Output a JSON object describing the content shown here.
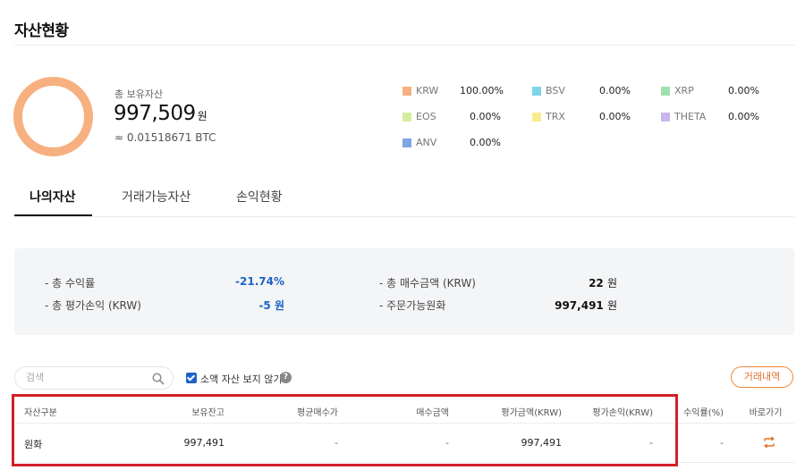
{
  "page": {
    "title": "자산현황"
  },
  "holdings": {
    "total_label": "총 보유자산",
    "total_value": "997,509",
    "total_unit": "원",
    "btc_equivalent": "≈ 0.01518671 BTC",
    "donut_color": "#f7b07f"
  },
  "legend": [
    {
      "name": "KRW",
      "pct": "100.00%",
      "color": "#f7b07f"
    },
    {
      "name": "BSV",
      "pct": "0.00%",
      "color": "#7fd4ea"
    },
    {
      "name": "XRP",
      "pct": "0.00%",
      "color": "#9fe0b0"
    },
    {
      "name": "EOS",
      "pct": "0.00%",
      "color": "#d3ec9f"
    },
    {
      "name": "TRX",
      "pct": "0.00%",
      "color": "#f7ec8e"
    },
    {
      "name": "THETA",
      "pct": "0.00%",
      "color": "#c9b6ec"
    },
    {
      "name": "ANV",
      "pct": "0.00%",
      "color": "#7ea6e6"
    }
  ],
  "tabs": [
    {
      "label": "나의자산",
      "active": true
    },
    {
      "label": "거래가능자산",
      "active": false
    },
    {
      "label": "손익현황",
      "active": false
    }
  ],
  "summary": {
    "total_return_label": "- 총 수익률",
    "total_return_value": "-21.74%",
    "total_pnl_label": "- 총 평가손익 (KRW)",
    "total_pnl_value": "-5 원",
    "total_buy_label": "- 총 매수금액 (KRW)",
    "total_buy_value": "22",
    "total_buy_unit": "원",
    "orderable_label": "- 주문가능원화",
    "orderable_value": "997,491",
    "orderable_unit": "원"
  },
  "search": {
    "placeholder": "검색",
    "value": ""
  },
  "options": {
    "hide_small_label": "소액 자산 보지 않기",
    "hide_small_checked": true,
    "help": "?"
  },
  "history_button": "거래내역",
  "table": {
    "headers": [
      "자산구분",
      "보유잔고",
      "평균매수가",
      "매수금액",
      "평가금액(KRW)",
      "평가손익(KRW)",
      "수익률(%)",
      "바로가기"
    ],
    "rows": [
      [
        "원화",
        "997,491",
        "-",
        "-",
        "997,491",
        "-",
        "-",
        "swap-icon"
      ]
    ]
  },
  "colors": {
    "accent_blue": "#1d63c8",
    "accent_orange": "#e0702a",
    "highlight_red": "#d31f27"
  }
}
